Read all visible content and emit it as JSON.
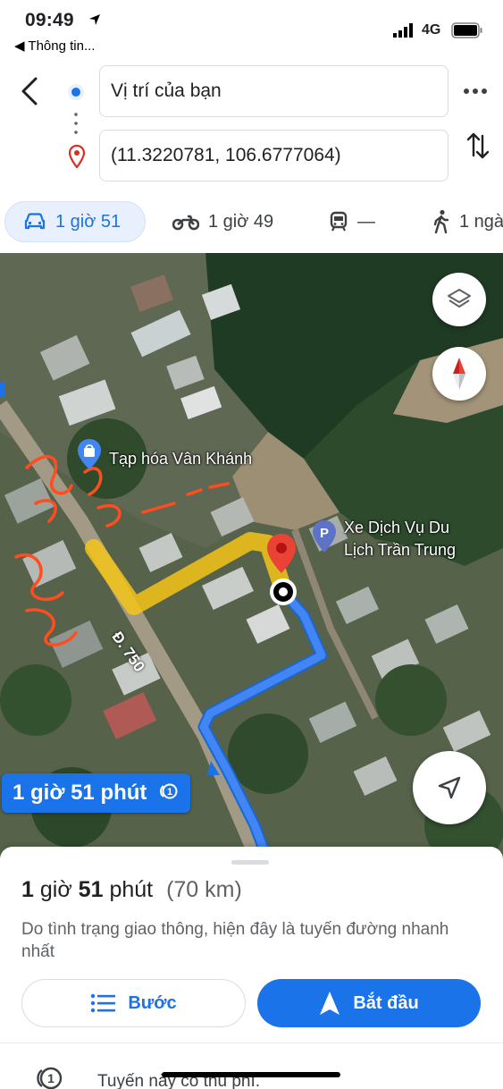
{
  "status_bar": {
    "time": "09:49",
    "back_app": "◀ Thông tin...",
    "network": "4G"
  },
  "directions": {
    "origin": "Vị trí của bạn",
    "destination": "(11.3220781, 106.6777064)"
  },
  "modes": [
    {
      "name": "car",
      "label": "1 giờ 51",
      "active": true
    },
    {
      "name": "motorbike",
      "label": "1 giờ 49"
    },
    {
      "name": "transit",
      "label": "—"
    },
    {
      "name": "walk",
      "label": "1 ngà"
    }
  ],
  "map": {
    "poi_shop": "Tạp hóa Vân Khánh",
    "poi_parking_line1": "Xe Dịch Vụ Du",
    "poi_parking_line2": "Lịch Trần Trung",
    "road_label": "Đ. 750",
    "eta_callout": "1 giờ 51 phút"
  },
  "sheet": {
    "duration_h": "1",
    "duration_h_unit": "giờ",
    "duration_m": "51",
    "duration_m_unit": "phút",
    "distance": "(70 km)",
    "note": "Do tình trạng giao thông, hiện đây là tuyến đường nhanh nhất",
    "steps_label": "Bước",
    "start_label": "Bắt đầu",
    "toll_note": "Tuyến này có thu phí."
  },
  "colors": {
    "accent": "#1a73e8",
    "route": "#4285f4",
    "pin": "#ea4335",
    "highlight": "#f5c518"
  }
}
